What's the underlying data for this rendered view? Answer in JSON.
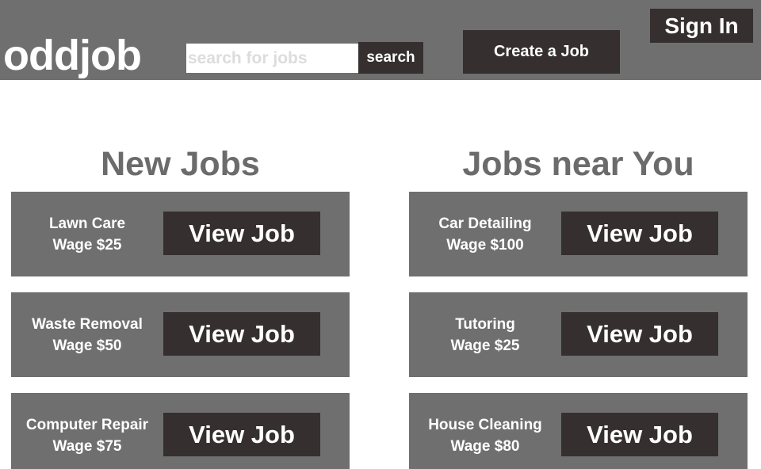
{
  "header": {
    "logo": "oddjob",
    "search": {
      "placeholder": "search for jobs",
      "value": "",
      "button_label": "search"
    },
    "create_job_label": "Create a Job",
    "sign_in_label": "Sign In"
  },
  "sections": {
    "new_jobs": {
      "title": "New Jobs",
      "jobs": [
        {
          "title": "Lawn Care",
          "wage": "Wage $25",
          "button_label": "View Job"
        },
        {
          "title": "Waste Removal",
          "wage": "Wage $50",
          "button_label": "View Job"
        },
        {
          "title": "Computer Repair",
          "wage": "Wage $75",
          "button_label": "View Job"
        }
      ]
    },
    "jobs_near_you": {
      "title": "Jobs near You",
      "jobs": [
        {
          "title": "Car Detailing",
          "wage": "Wage $100",
          "button_label": "View Job"
        },
        {
          "title": "Tutoring",
          "wage": "Wage $25",
          "button_label": "View Job"
        },
        {
          "title": "House Cleaning",
          "wage": "Wage $80",
          "button_label": "View Job"
        }
      ]
    }
  },
  "colors": {
    "header_bg": "#6f6f6f",
    "button_bg": "#352f30",
    "heading": "#6b6b6b"
  }
}
